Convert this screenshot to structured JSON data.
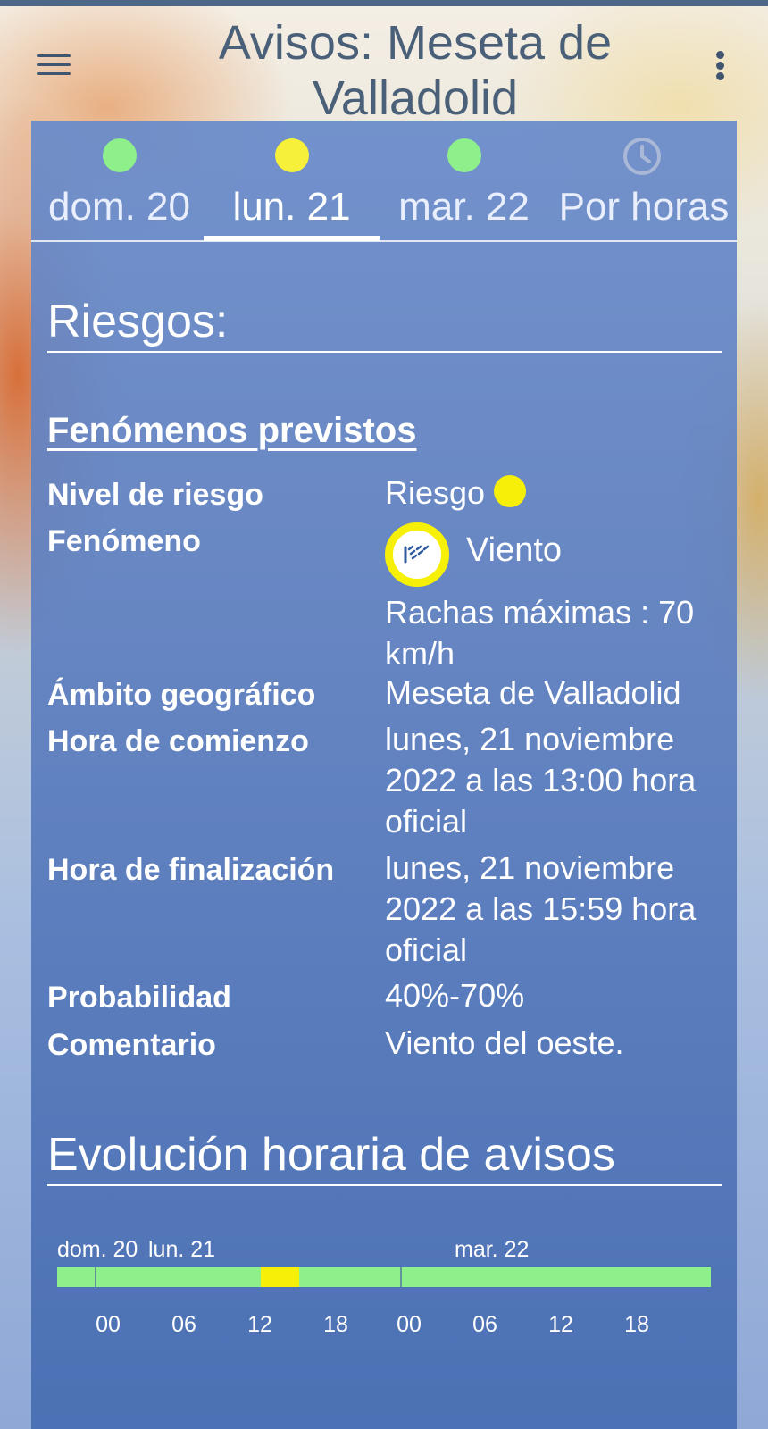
{
  "header": {
    "title": "Avisos: Meseta de Valladolid"
  },
  "tabs": [
    {
      "label": "dom. 20",
      "dot_color": "#8ef08a"
    },
    {
      "label": "lun. 21",
      "dot_color": "#f6f03a",
      "active": true
    },
    {
      "label": "mar. 22",
      "dot_color": "#8ef08a"
    },
    {
      "label": "Por horas",
      "icon": "clock-icon"
    }
  ],
  "risks": {
    "title": "Riesgos:",
    "subtitle": "Fenómenos previstos",
    "labels": {
      "level": "Nivel de riesgo",
      "phenomenon": "Fenómeno",
      "area": "Ámbito geográfico",
      "start": "Hora de comienzo",
      "end": "Hora de finalización",
      "probability": "Probabilidad",
      "comment": "Comentario"
    },
    "values": {
      "level": "Riesgo",
      "level_color": "#f6f008",
      "phenomenon": "Viento",
      "phenomenon_icon": "wind-icon",
      "gusts": "Rachas máximas : 70 km/h",
      "area": "Meseta de Valladolid",
      "start": "lunes, 21 noviembre 2022 a las 13:00 hora oficial",
      "end": "lunes, 21 noviembre 2022 a las 15:59 hora oficial",
      "probability": "40%-70%",
      "comment": "Viento del oeste."
    }
  },
  "evolution": {
    "title": "Evolución horaria de avisos",
    "days": [
      "dom. 20",
      "lun. 21",
      "mar. 22"
    ],
    "hours": [
      "00",
      "06",
      "12",
      "18",
      "00",
      "06",
      "12",
      "18"
    ],
    "colors": {
      "green": "#8ef08a",
      "yellow": "#f6f008"
    }
  }
}
